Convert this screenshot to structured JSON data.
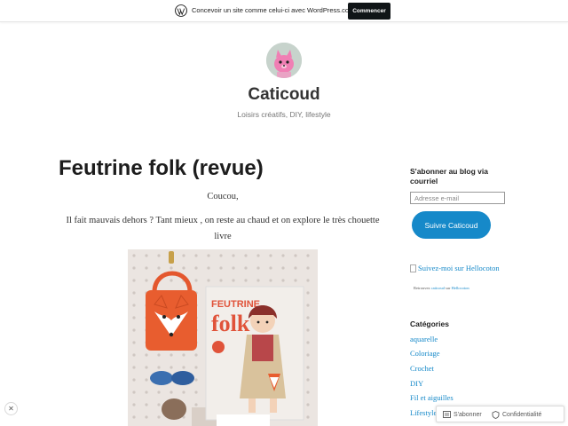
{
  "wp_banner": {
    "icon": "wordpress-logo-icon",
    "text": "Concevoir un site comme celui-ci avec WordPress.com",
    "button_label": "Commencer"
  },
  "header": {
    "avatar": "pink-fox-avatar",
    "site_title": "Caticoud",
    "tagline": "Loisirs créatifs, DIY, lifestyle"
  },
  "post": {
    "title": "Feutrine folk (revue)",
    "greeting": "Coucou,",
    "paragraph": "Il fait mauvais dehors ? Tant mieux , on reste au chaud et on explore le très chouette livre",
    "image": {
      "book_title_line1": "FEUTRINE",
      "book_title_line2": "folk"
    }
  },
  "sidebar": {
    "subscribe_heading": "S'abonner au blog via courriel",
    "email_placeholder": "Adresse e-mail",
    "follow_button": "Suivre Caticoud",
    "hellocoton_image_alt": "Suivez-moi sur Hellocoton",
    "hellocoton_small_prefix": "Retrouvez ",
    "hellocoton_small_name": "caticoud",
    "hellocoton_small_mid": " sur ",
    "hellocoton_small_link": "Hellocoton",
    "categories_heading": "Catégories",
    "categories": [
      "aquarelle",
      "Coloriage",
      "Crochet",
      "DIY",
      "Fil et aiguilles",
      "Lifestyle"
    ]
  },
  "action_bar": {
    "subscribe_label": "S'abonner",
    "privacy_label": "Confidentialité"
  },
  "colors": {
    "link": "#1689c9",
    "button_dark": "#101517",
    "follow_button": "#1689c9"
  }
}
